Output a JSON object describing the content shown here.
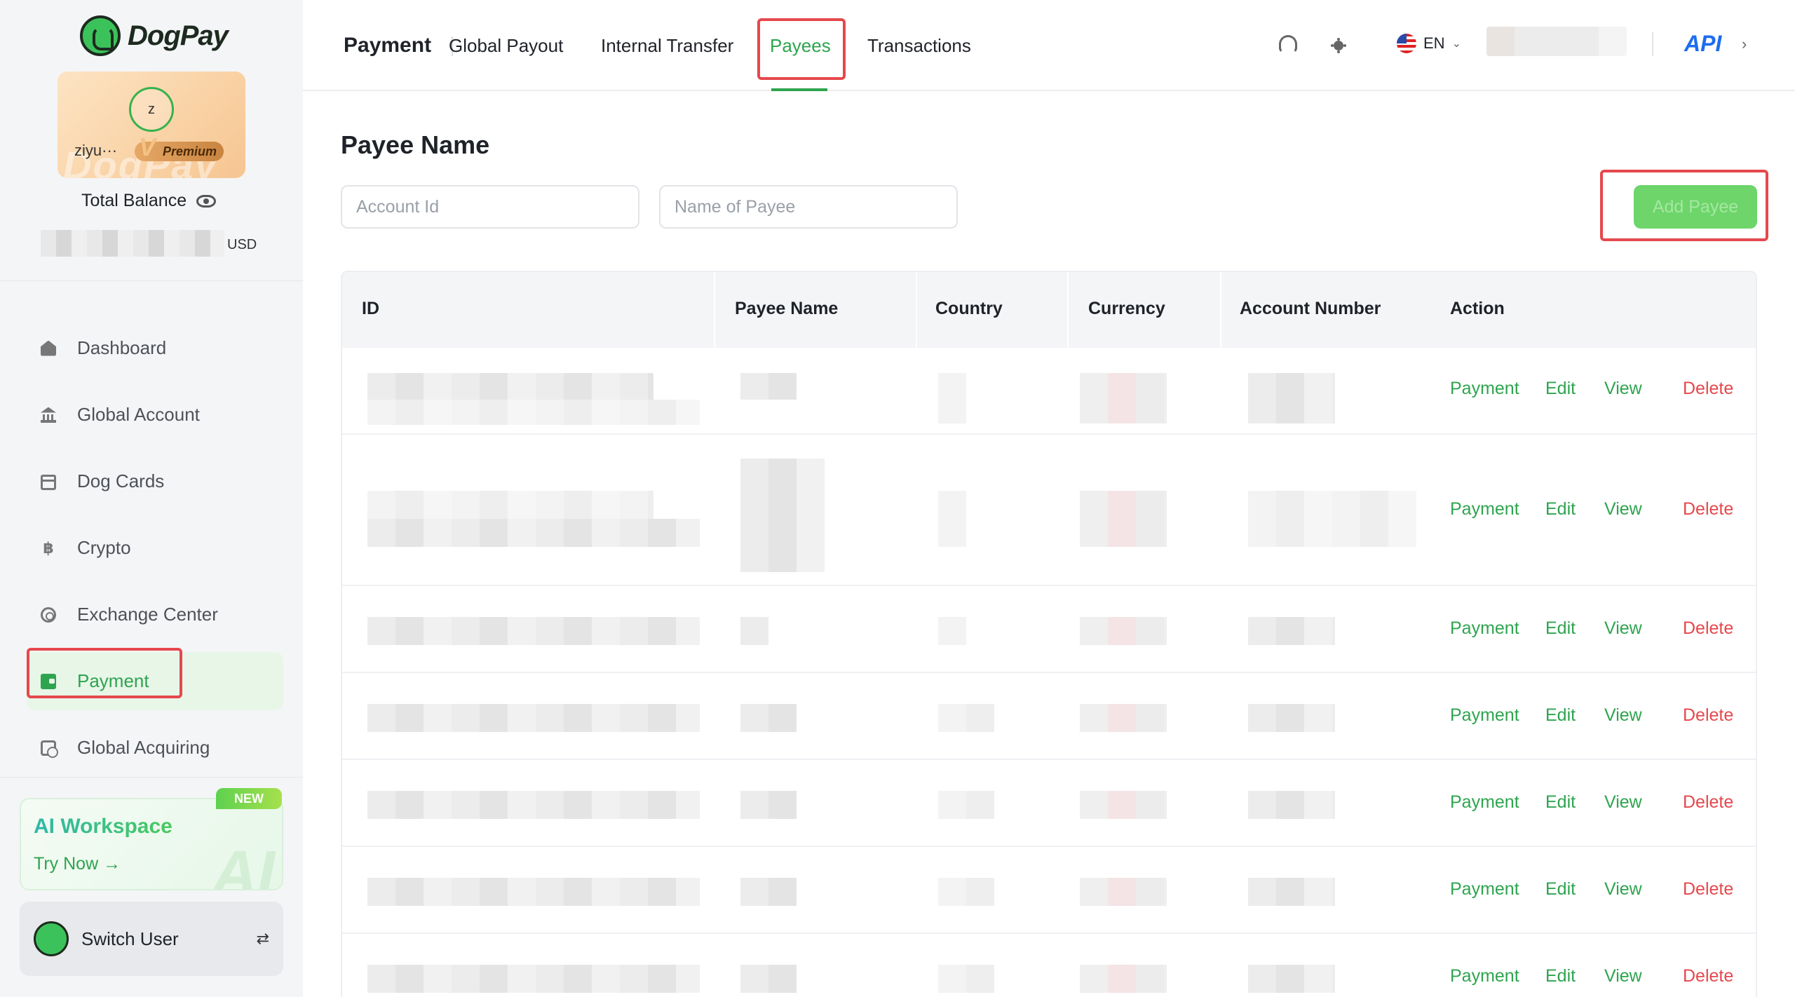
{
  "app": {
    "brand": "DogPay"
  },
  "sidebar": {
    "user": {
      "avatar_letter": "z",
      "name": "ziyu···",
      "tier": "Premium"
    },
    "balance": {
      "label": "Total Balance",
      "currency": "USD"
    },
    "nav": [
      {
        "label": "Dashboard",
        "icon": "home-icon",
        "active": false
      },
      {
        "label": "Global Account",
        "icon": "bank-icon",
        "active": false
      },
      {
        "label": "Dog Cards",
        "icon": "card-icon",
        "active": false
      },
      {
        "label": "Crypto",
        "icon": "bitcoin-icon",
        "active": false
      },
      {
        "label": "Exchange Center",
        "icon": "exchange-icon",
        "active": false
      },
      {
        "label": "Payment",
        "icon": "wallet-icon",
        "active": true
      },
      {
        "label": "Global Acquiring",
        "icon": "acquiring-icon",
        "active": false
      }
    ],
    "ai_card": {
      "title": "AI Workspace",
      "cta": "Try Now →",
      "badge": "NEW"
    },
    "switch_user": {
      "label": "Switch User",
      "icon": "⇄"
    }
  },
  "header": {
    "section": "Payment",
    "tabs": [
      {
        "label": "Global Payout",
        "active": false
      },
      {
        "label": "Internal Transfer",
        "active": false
      },
      {
        "label": "Payees",
        "active": true
      },
      {
        "label": "Transactions",
        "active": false
      }
    ],
    "language": "EN",
    "api_label": "API",
    "api_chevron": "›"
  },
  "main": {
    "title": "Payee Name",
    "filters": {
      "account_id_placeholder": "Account Id",
      "payee_name_placeholder": "Name of Payee"
    },
    "add_button": "Add Payee",
    "table": {
      "columns": [
        "ID",
        "Payee Name",
        "Country",
        "Currency",
        "Account Number",
        "Action"
      ],
      "actions": {
        "payment": "Payment",
        "edit": "Edit",
        "view": "View",
        "delete": "Delete"
      },
      "row_count": 7
    }
  },
  "colors": {
    "accent": "#2ea44f",
    "danger": "#e5484d",
    "api": "#1d6cf0",
    "highlight_outline": "#e5484d"
  }
}
